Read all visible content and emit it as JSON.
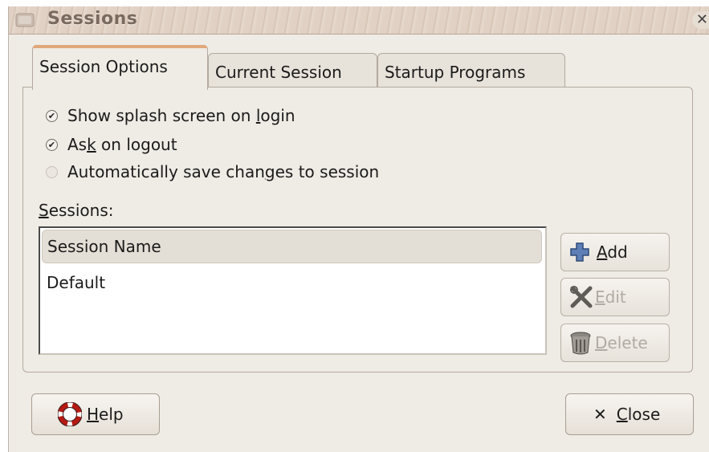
{
  "window": {
    "title": "Sessions",
    "close_glyph": "✕"
  },
  "tabs": [
    {
      "label": "Session Options",
      "active": true
    },
    {
      "label": "Current Session",
      "active": false
    },
    {
      "label": "Startup Programs",
      "active": false
    }
  ],
  "options": [
    {
      "pre": "Show splash screen on ",
      "mn": "l",
      "post": "ogin",
      "checked": true,
      "enabled": true
    },
    {
      "pre": "As",
      "mn": "k",
      "post": " on logout",
      "checked": true,
      "enabled": true
    },
    {
      "pre": "Automatically save chan",
      "mn": "g",
      "post": "es to session",
      "checked": false,
      "enabled": false
    }
  ],
  "sessions": {
    "label_mn": "S",
    "label_rest": "essions:",
    "column_header": "Session Name",
    "rows": [
      "Default"
    ]
  },
  "side_buttons": {
    "add": {
      "mn": "A",
      "rest": "dd",
      "icon": "plus-icon",
      "enabled": true
    },
    "edit": {
      "mn": "E",
      "rest": "dit",
      "icon": "tools-icon",
      "enabled": false
    },
    "delete": {
      "mn": "D",
      "rest": "elete",
      "icon": "trash-icon",
      "enabled": false
    }
  },
  "footer": {
    "help": {
      "mn": "H",
      "rest": "elp",
      "icon": "lifebuoy-icon"
    },
    "close": {
      "mn": "C",
      "rest": "lose",
      "icon": "close-icon",
      "glyph": "✕"
    }
  },
  "colors": {
    "window_bg": "#efebe5",
    "active_tab_accent": "#e0a87a",
    "add_icon": "#5d7fb5"
  }
}
